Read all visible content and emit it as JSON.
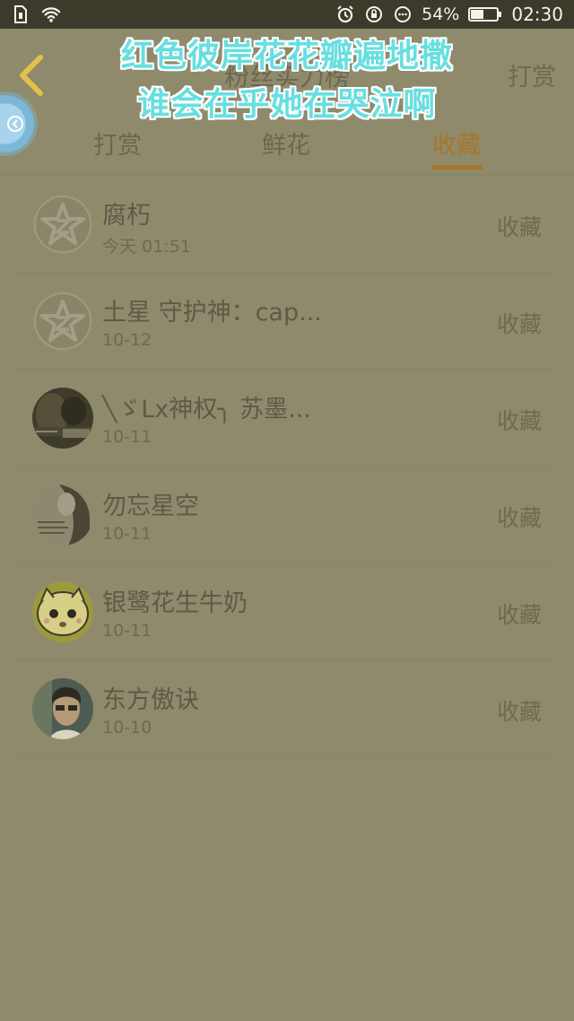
{
  "status_bar": {
    "battery": "54%",
    "battery_level": 0.54,
    "time": "02:30",
    "icons": [
      "sim-icon",
      "wifi-icon",
      "alarm-icon",
      "rotation-lock-icon",
      "more-dots-icon",
      "battery-icon"
    ]
  },
  "header": {
    "title": "粉丝实力榜",
    "reward_link": "打赏"
  },
  "overlay_lyrics": [
    "红色彼岸花花瓣遍地撒",
    "谁会在乎她在哭泣啊"
  ],
  "tabs": [
    {
      "label": "打赏",
      "active": false
    },
    {
      "label": "鲜花",
      "active": false
    },
    {
      "label": "收藏",
      "active": true
    }
  ],
  "list": [
    {
      "name": "腐朽",
      "time": "今天 01:51",
      "action": "收藏",
      "avatar": "default-qzone-avatar"
    },
    {
      "name": "土星 守护神：cap...",
      "time": "10-12",
      "action": "收藏",
      "avatar": "default-qzone-avatar"
    },
    {
      "name": "╲ゞLx神权╮ 苏墨...",
      "time": "10-11",
      "action": "收藏",
      "avatar": "dark-photo-avatar"
    },
    {
      "name": "勿忘星空",
      "time": "10-11",
      "action": "收藏",
      "avatar": "girl-photo-avatar"
    },
    {
      "name": "银鹭花生牛奶",
      "time": "10-11",
      "action": "收藏",
      "avatar": "cartoon-avatar"
    },
    {
      "name": "东方傲诀",
      "time": "10-10",
      "action": "收藏",
      "avatar": "man-photo-avatar"
    }
  ],
  "colors": {
    "background": "#8f8a6b",
    "accent": "#a8762a",
    "status_bar": "#3c3a2a",
    "overlay_text": "#67dfe0"
  }
}
